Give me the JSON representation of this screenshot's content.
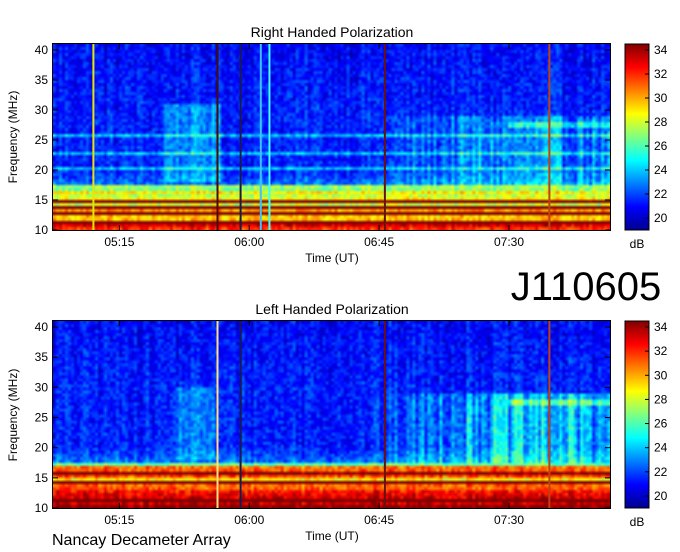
{
  "page": {
    "id_label": "J110605",
    "footer": "Nancay Decameter Array"
  },
  "chart_data": [
    {
      "type": "heatmap",
      "title": "Right Handed Polarization",
      "xlabel": "Time (UT)",
      "ylabel": "Frequency (MHz)",
      "x_ticks": [
        "05:15",
        "06:00",
        "06:45",
        "07:30"
      ],
      "x_tick_minutes": [
        315,
        360,
        405,
        450
      ],
      "xlim_minutes": [
        292,
        485
      ],
      "y_ticks": [
        10,
        15,
        20,
        25,
        30,
        35,
        40
      ],
      "ylim": [
        10,
        41
      ],
      "colorbar": {
        "label": "dB",
        "ticks": [
          20,
          22,
          24,
          26,
          28,
          30,
          32,
          34
        ],
        "range": [
          19,
          34.5
        ]
      },
      "colormap": [
        "#00008f",
        "#0000ff",
        "#0080ff",
        "#00ffff",
        "#80ff80",
        "#ffff00",
        "#ff8000",
        "#ff0000",
        "#800000"
      ],
      "vertical_features_minutes": [
        {
          "t": 306,
          "color": "#e6e600"
        },
        {
          "t": 349,
          "color": "#4a0a0a"
        },
        {
          "t": 357,
          "color": "#1a1a4a"
        },
        {
          "t": 364,
          "color": "#40c0ff"
        },
        {
          "t": 367,
          "color": "#40ffff"
        },
        {
          "t": 407,
          "color": "#6a1010"
        },
        {
          "t": 464,
          "color": "#c04010"
        }
      ]
    },
    {
      "type": "heatmap",
      "title": "Left Handed Polarization",
      "xlabel": "Time (UT)",
      "ylabel": "Frequency (MHz)",
      "x_ticks": [
        "05:15",
        "06:00",
        "06:45",
        "07:30"
      ],
      "x_tick_minutes": [
        315,
        360,
        405,
        450
      ],
      "xlim_minutes": [
        292,
        485
      ],
      "y_ticks": [
        10,
        15,
        20,
        25,
        30,
        35,
        40
      ],
      "ylim": [
        10,
        41
      ],
      "colorbar": {
        "label": "dB",
        "ticks": [
          20,
          22,
          24,
          26,
          28,
          30,
          32,
          34
        ],
        "range": [
          19,
          34.5
        ]
      },
      "colormap": [
        "#00008f",
        "#0000ff",
        "#0080ff",
        "#00ffff",
        "#80ff80",
        "#ffff00",
        "#ff8000",
        "#ff0000",
        "#800000"
      ],
      "vertical_features_minutes": [
        {
          "t": 349,
          "color": "#ffe080"
        },
        {
          "t": 357,
          "color": "#1a1a4a"
        },
        {
          "t": 407,
          "color": "#6a1010"
        },
        {
          "t": 464,
          "color": "#c04010"
        }
      ]
    }
  ]
}
